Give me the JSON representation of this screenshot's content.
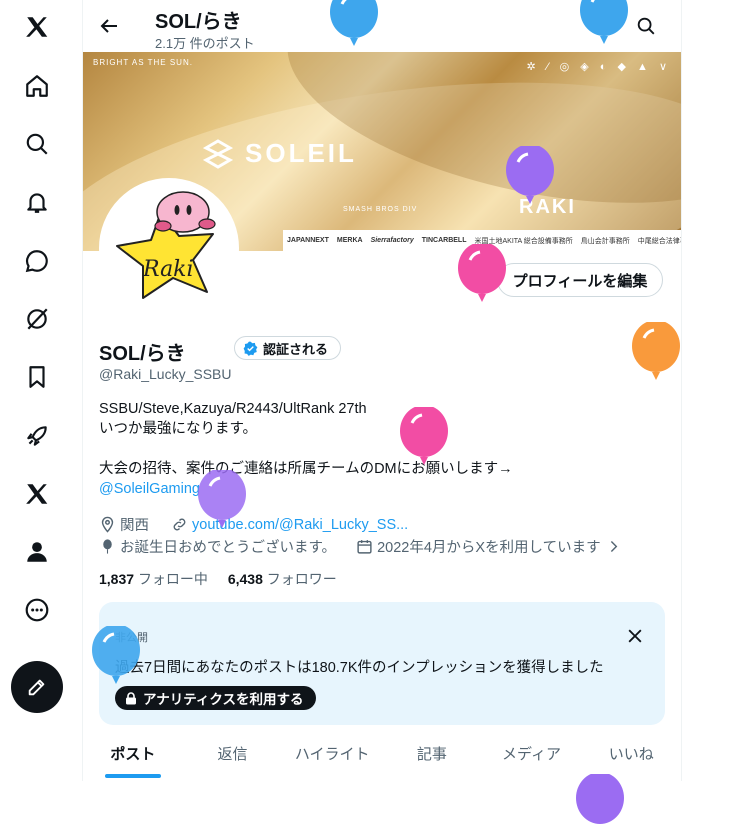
{
  "nav": {
    "items": [
      "x-logo-icon",
      "home-icon",
      "search-icon",
      "bell-icon",
      "messages-icon",
      "grok-icon",
      "bookmark-icon",
      "rocket-icon",
      "x-premium-icon",
      "profile-icon",
      "more-icon"
    ],
    "compose": "compose-icon"
  },
  "header": {
    "title": "SOL/らき",
    "post_count": "2.1万 件のポスト"
  },
  "banner": {
    "tagline": "BRIGHT AS THE SUN.",
    "team": "SOLEIL",
    "division": "SMASH BROS DIV",
    "player": "RAKI",
    "sponsors": [
      "JAPANNEXT",
      "MERKA",
      "Sierrafactory",
      "TINCARBELL",
      "米国土地AKITA 総合設備事務所",
      "鳥山会計事務所",
      "中尾総合法律事務所"
    ]
  },
  "avatar": {
    "text": "Raki"
  },
  "profile": {
    "edit_label": "プロフィールを編集",
    "name": "SOL/らき",
    "verify_label": "認証される",
    "handle": "@Raki_Lucky_SSBU",
    "bio": [
      "SSBU/Steve,Kazuya/R2443/UltRank 27th",
      "いつか最強になります。",
      "",
      "大会の招待、案件のご連絡は所属チームのDMにお願いします→"
    ],
    "bio_link": "@SoleilGaming",
    "location": "関西",
    "website": "youtube.com/@Raki_Lucky_SS...",
    "birthday": "お誕生日おめでとうございます。",
    "joined": "2022年4月からXを利用しています",
    "following_count": "1,837",
    "following_label": "フォロー中",
    "followers_count": "6,438",
    "followers_label": "フォロワー"
  },
  "analytics": {
    "label": "非公開",
    "text": "過去7日間にあなたのポストは180.7K件のインプレッションを獲得しました",
    "button": "アナリティクスを利用する"
  },
  "tabs": [
    "ポスト",
    "返信",
    "ハイライト",
    "記事",
    "メディア",
    "いいね"
  ],
  "colors": {
    "accent": "#1d9bf0",
    "balloon_blue": "#3ea6ed",
    "balloon_purple": "#9b6cf2",
    "balloon_pink": "#f24da4",
    "balloon_orange": "#f99a3c"
  }
}
